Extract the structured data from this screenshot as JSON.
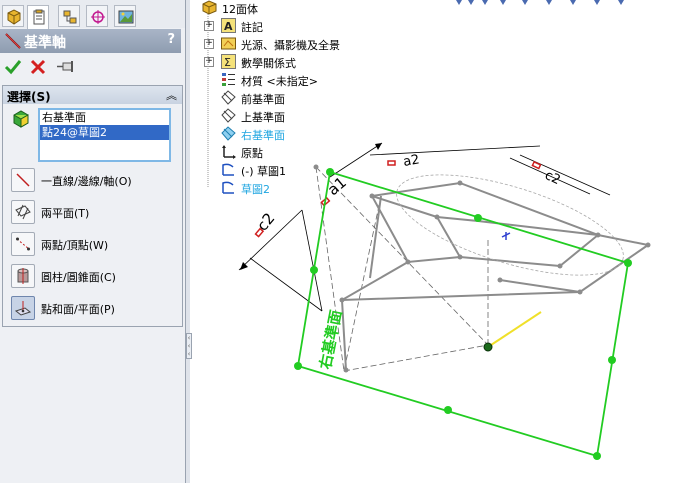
{
  "tabs": [
    {
      "name": "featuremanager-tab-icon"
    },
    {
      "name": "propertymanager-tab-icon"
    },
    {
      "name": "configurationmanager-tab-icon"
    },
    {
      "name": "dimxpert-tab-icon"
    },
    {
      "name": "display-manager-tab-icon"
    }
  ],
  "pm": {
    "title": "基準軸",
    "help": "?"
  },
  "selection": {
    "title": "選擇(S)",
    "collapse": "︽",
    "items": [
      "右基準面",
      "點24@草圖2"
    ],
    "options": [
      {
        "label": "一直線/邊線/軸(O)"
      },
      {
        "label": "兩平面(T)"
      },
      {
        "label": "兩點/頂點(W)"
      },
      {
        "label": "圓柱/圓錐面(C)"
      },
      {
        "label": "點和面/平面(P)"
      }
    ]
  },
  "tree": {
    "root": "12面体",
    "items": [
      {
        "label": "註記",
        "expand": "+"
      },
      {
        "label": "光源、攝影機及全景",
        "expand": "+"
      },
      {
        "label": "數學關係式",
        "expand": "+"
      },
      {
        "label": "材質 <未指定>"
      },
      {
        "label": "前基準面"
      },
      {
        "label": "上基準面"
      },
      {
        "label": "右基準面"
      },
      {
        "label": "原點"
      },
      {
        "label": "(-) 草圖1"
      },
      {
        "label": "草圖2"
      }
    ]
  },
  "viewport": {
    "plane_label": "右基準面",
    "dim_labels": [
      "a1",
      "c2",
      "a2",
      "c2"
    ]
  },
  "colors": {
    "plane_green": "#22cc22",
    "selected_blue": "#3169c6",
    "highlight_cyan": "#1ea5e0",
    "axis_yellow": "#f0e02a",
    "sketch_gray": "#8c8c8c"
  }
}
